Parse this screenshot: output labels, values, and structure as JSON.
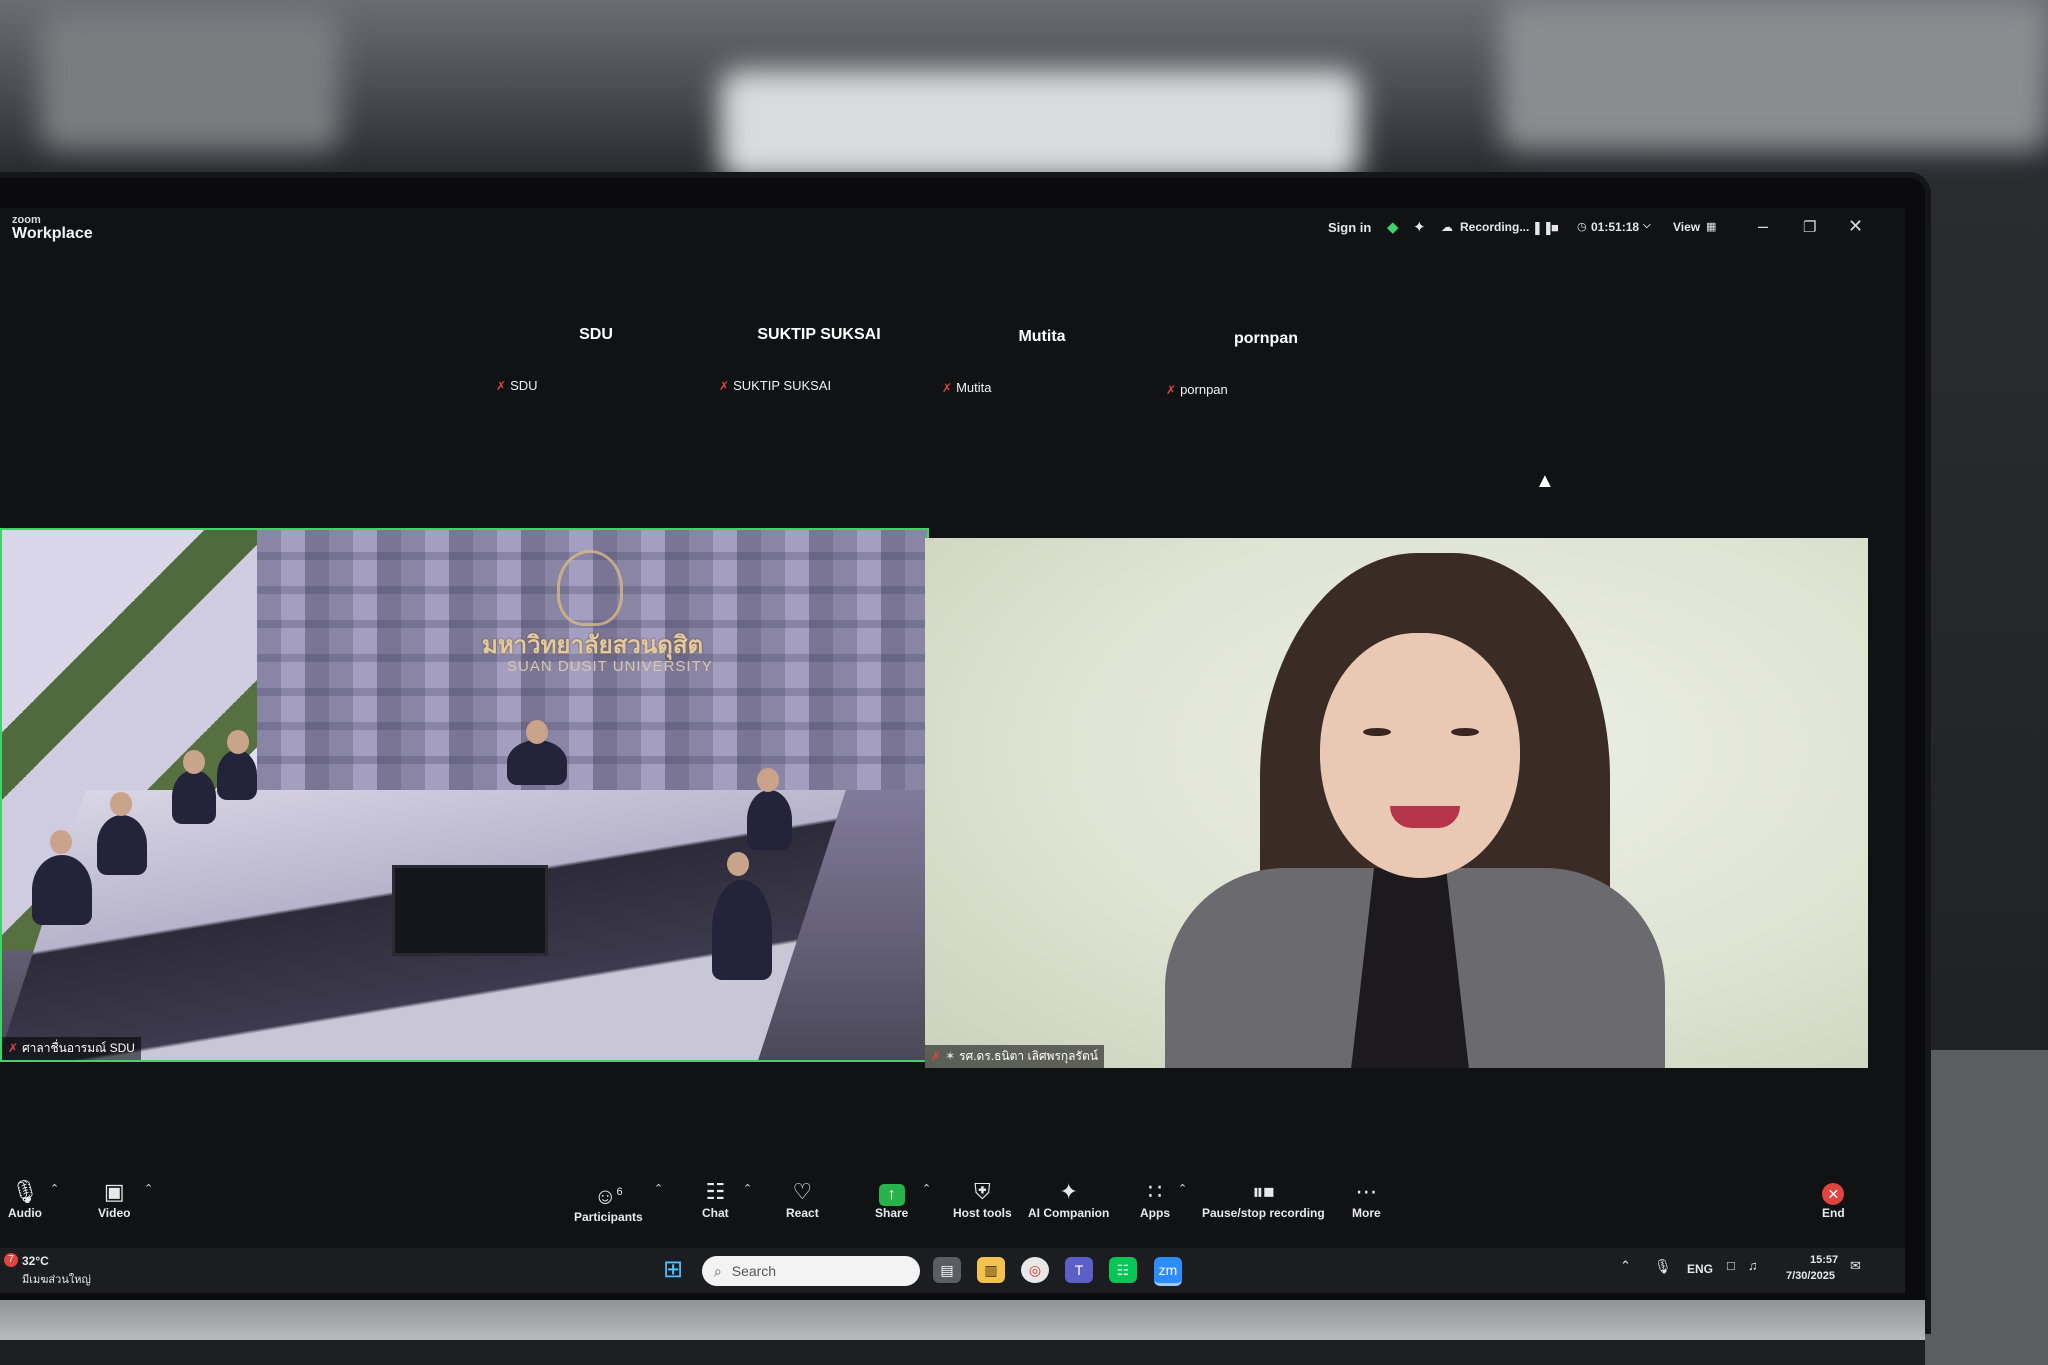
{
  "titlebar": {
    "logo_small": "zoom",
    "logo_large": "Workplace",
    "sign_in": "Sign in",
    "recording_label": "Recording...",
    "timer": "01:51:18",
    "view_label": "View"
  },
  "participants_strip": [
    {
      "big_name": "SDU",
      "small_name": "SDU"
    },
    {
      "big_name": "SUKTIP SUKSAI",
      "small_name": "SUKTIP SUKSAI"
    },
    {
      "big_name": "Mutita",
      "small_name": "Mutita"
    },
    {
      "big_name": "pornpan",
      "small_name": "pornpan"
    }
  ],
  "videos": {
    "room": {
      "university_thai": "มหาวิทยาลัยสวนดุสิต",
      "university_en": "SUAN DUSIT UNIVERSITY",
      "name_tag": "ศาลาชื่นอารมณ์ SDU"
    },
    "speaker": {
      "name_tag": "รศ.ดร.ธนิตา เลิศพรกุลรัตน์"
    }
  },
  "toolbar": {
    "audio": "Audio",
    "video": "Video",
    "participants": "Participants",
    "participants_count": "6",
    "chat": "Chat",
    "react": "React",
    "share": "Share",
    "host_tools": "Host tools",
    "ai_companion": "AI Companion",
    "apps": "Apps",
    "pause_stop": "Pause/stop recording",
    "more": "More",
    "end": "End"
  },
  "taskbar": {
    "weather_temp": "32°C",
    "weather_desc": "มีเมฆส่วนใหญ่",
    "weather_badge": "7",
    "search_placeholder": "Search",
    "lang": "ENG",
    "time": "15:57",
    "date": "7/30/2025"
  },
  "colors": {
    "active_speaker_border": "#3fd46a",
    "mic_off": "#e0443e",
    "share_green": "#27b24a",
    "end_red": "#e0443e"
  }
}
